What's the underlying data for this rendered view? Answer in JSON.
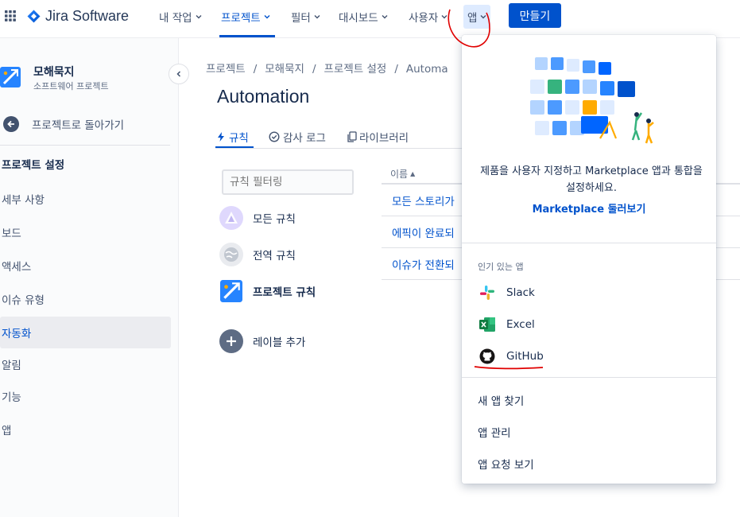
{
  "header": {
    "product_name": "Jira Software",
    "nav": [
      {
        "label": "내 작업"
      },
      {
        "label": "프로젝트"
      },
      {
        "label": "필터"
      },
      {
        "label": "대시보드"
      },
      {
        "label": "사용자"
      },
      {
        "label": "앱"
      }
    ],
    "active_nav": "프로젝트",
    "create_label": "만들기"
  },
  "sidebar": {
    "project_name": "모해묵지",
    "project_type": "소프트웨어 프로젝트",
    "back_label": "프로젝트로 돌아가기",
    "heading": "프로젝트 설정",
    "items": [
      {
        "label": "세부 사항"
      },
      {
        "label": "보드"
      },
      {
        "label": "액세스"
      },
      {
        "label": "이슈 유형"
      },
      {
        "label": "자동화"
      },
      {
        "label": "알림"
      },
      {
        "label": "기능"
      },
      {
        "label": "앱"
      }
    ],
    "selected": "자동화"
  },
  "main": {
    "breadcrumb": [
      "프로젝트",
      "모해묵지",
      "프로젝트 설정",
      "Automa"
    ],
    "title": "Automation",
    "tabs": [
      {
        "label": "규칙"
      },
      {
        "label": "감사 로그"
      },
      {
        "label": "라이브러리"
      }
    ],
    "filter_placeholder": "규칙 필터링",
    "filters": [
      {
        "label": "모든 규칙"
      },
      {
        "label": "전역 규칙"
      },
      {
        "label": "프로젝트 규칙"
      }
    ],
    "add_label": "레이블 추가",
    "table_header": "이름",
    "rules": [
      {
        "name": "모든 스토리가"
      },
      {
        "name": "에픽이 완료되"
      },
      {
        "name": "이슈가 전환되"
      }
    ]
  },
  "dropdown": {
    "description": "제품을 사용자 지정하고 Marketplace 앱과 통합을 설정하세요.",
    "marketplace_link": "Marketplace 둘러보기",
    "section_title": "인기 있는 앱",
    "apps": [
      {
        "name": "Slack",
        "icon": "slack-icon"
      },
      {
        "name": "Excel",
        "icon": "excel-icon"
      },
      {
        "name": "GitHub",
        "icon": "github-icon"
      }
    ],
    "actions": [
      {
        "label": "새 앱 찾기"
      },
      {
        "label": "앱 관리"
      },
      {
        "label": "앱 요청 보기"
      }
    ]
  },
  "colors": {
    "brand": "#0052cc",
    "annotation": "#e00000"
  }
}
